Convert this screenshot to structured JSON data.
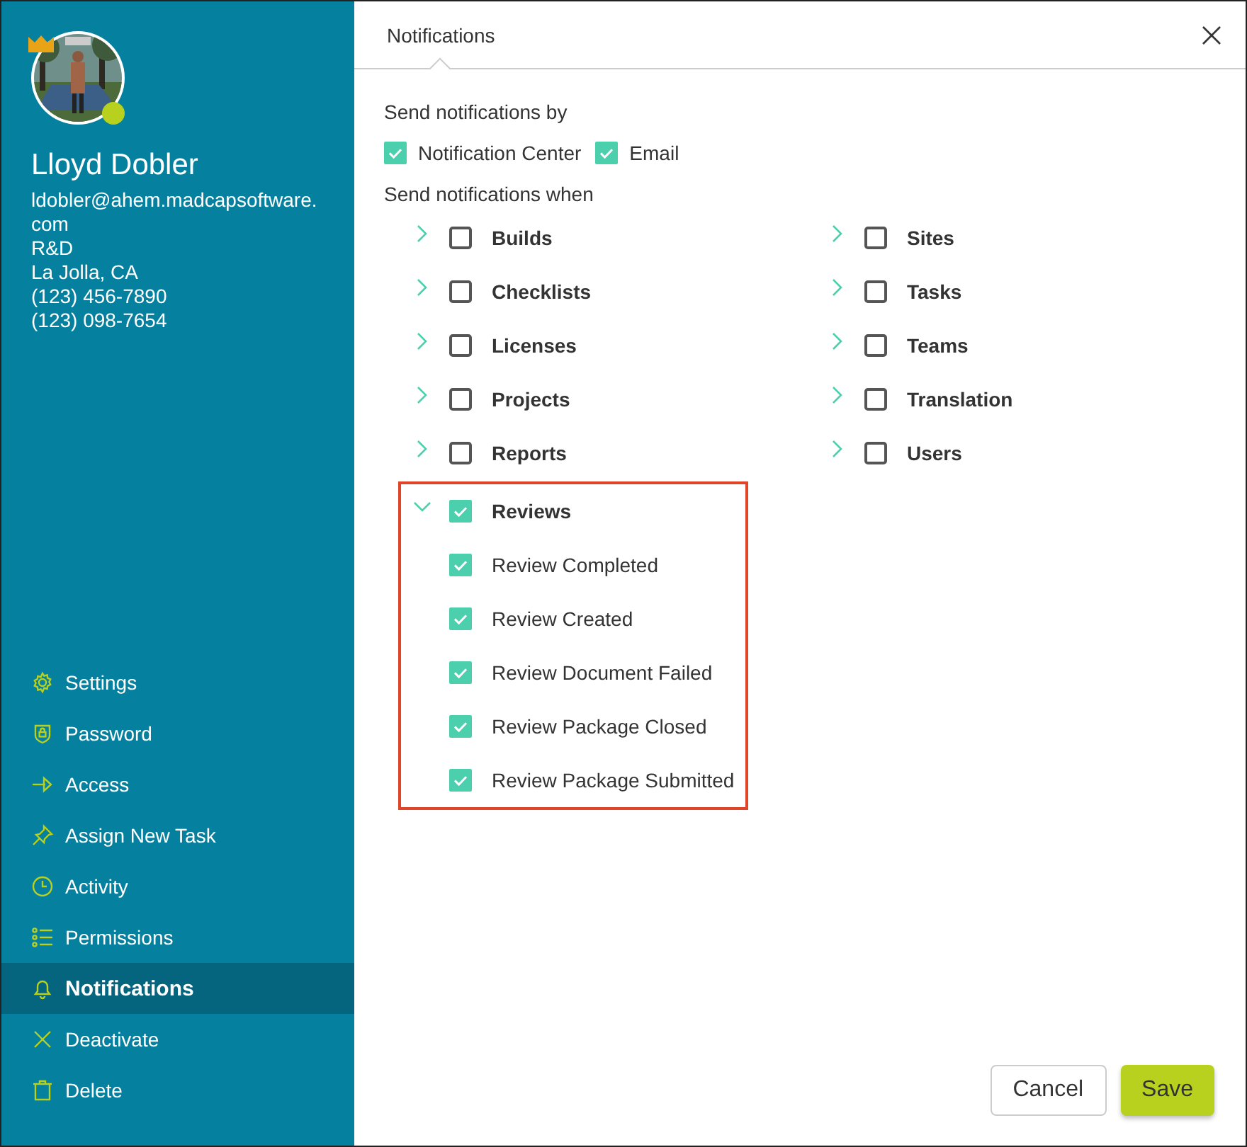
{
  "profile": {
    "name": "Lloyd Dobler",
    "online": true,
    "owner": true,
    "details": [
      "ldobler@ahem.madcapsoftware.com",
      "R&D",
      "La Jolla, CA",
      "(123) 456-7890",
      "(123) 098-7654"
    ]
  },
  "menu": [
    {
      "label": "Settings",
      "selected": false
    },
    {
      "label": "Password",
      "selected": false
    },
    {
      "label": "Access",
      "selected": false
    },
    {
      "label": "Assign New Task",
      "selected": false
    },
    {
      "label": "Activity",
      "selected": false
    },
    {
      "label": "Permissions",
      "selected": false
    },
    {
      "label": "Notifications",
      "selected": true
    },
    {
      "label": "Deactivate",
      "selected": false
    },
    {
      "label": "Delete",
      "selected": false
    }
  ],
  "tab": {
    "label": "Notifications",
    "selected": true
  },
  "send_by": {
    "label": "Send notifications by",
    "options": [
      {
        "label": "Notification Center",
        "checked": true
      },
      {
        "label": "Email",
        "checked": true
      }
    ]
  },
  "send_when": {
    "label": "Send notifications when",
    "left_column": [
      {
        "label": "Builds",
        "checked": false,
        "expanded": false
      },
      {
        "label": "Checklists",
        "checked": false,
        "expanded": false
      },
      {
        "label": "Licenses",
        "checked": false,
        "expanded": false
      },
      {
        "label": "Projects",
        "checked": false,
        "expanded": false
      },
      {
        "label": "Reports",
        "checked": false,
        "expanded": false
      },
      {
        "label": "Reviews",
        "checked": true,
        "expanded": true,
        "highlighted": true,
        "children": [
          {
            "label": "Review Completed",
            "checked": true
          },
          {
            "label": "Review Created",
            "checked": true
          },
          {
            "label": "Review Document Failed",
            "checked": true
          },
          {
            "label": "Review Package Closed",
            "checked": true
          },
          {
            "label": "Review Package Submitted",
            "checked": true
          }
        ]
      }
    ],
    "right_column": [
      {
        "label": "Sites",
        "checked": false,
        "expanded": false
      },
      {
        "label": "Tasks",
        "checked": false,
        "expanded": false
      },
      {
        "label": "Teams",
        "checked": false,
        "expanded": false
      },
      {
        "label": "Translation",
        "checked": false,
        "expanded": false
      },
      {
        "label": "Users",
        "checked": false,
        "expanded": false
      }
    ]
  },
  "buttons": [
    {
      "label": "Cancel",
      "kind": "secondary"
    },
    {
      "label": "Save",
      "kind": "primary"
    }
  ]
}
